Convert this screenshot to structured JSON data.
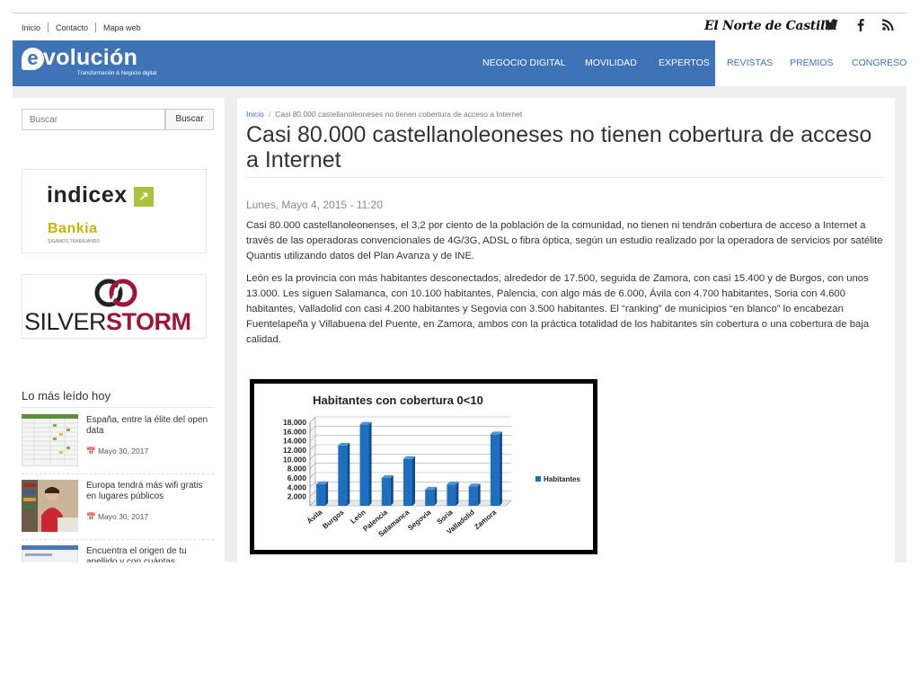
{
  "topbar": {
    "links": [
      "Inicio",
      "Contacto",
      "Mapa web"
    ],
    "brand": "El Norte de Castilla",
    "social_icons": [
      "twitter-icon",
      "facebook-icon",
      "rss-icon"
    ]
  },
  "header": {
    "logo_word": "volución",
    "logo_letter": "e",
    "logo_tagline": "Transformación & Negocio digital",
    "nav": [
      "NEGOCIO DIGITAL",
      "MOVILIDAD",
      "EXPERTOS",
      "REVISTAS",
      "PREMIOS",
      "CONGRESO"
    ],
    "accent": "#3e73b8"
  },
  "sidebar": {
    "search_placeholder": "Buscar",
    "search_button": "Buscar",
    "ad1": {
      "brand1": "indicex",
      "brand2": "Bankia",
      "brand2_tagline": "SIGAMOS TRABAJANDO"
    },
    "ad2": {
      "part1": "SILVER",
      "part2": "STORM"
    },
    "most_read_title": "Lo más leído hoy",
    "items": [
      {
        "title": "España, entre la élite del open data",
        "date": "Mayo 30, 2017"
      },
      {
        "title": "Europa tendrá más wifi gratis en lugares públicos",
        "date": "Mayo 30, 2017"
      },
      {
        "title": "Encuentra el origen de tu apellido y con cuántas personas",
        "date": ""
      }
    ]
  },
  "article": {
    "breadcrumb_home": "Inicio",
    "breadcrumb_current": "Casi 80.000 castellanoleoneses no tienen cobertura de acceso a Internet",
    "title": "Casi 80.000 castellanoleoneses no tienen cobertura de acceso a Internet",
    "date": "Lunes, Mayo 4, 2015 - 11:20",
    "paragraphs": [
      "Casi 80.000 castellanoleonenses, el 3,2 por ciento de la población de la comunidad, no tienen ni tendrán cobertura de acceso a Internet a través de las operadoras convencionales de 4G/3G, ADSL o fibra óptica, según un estudio realizado por la operadora de servicios por satélite Quantis utilizando datos del Plan Avanza y de INE.",
      "León es la provincia con más habitantes desconectados, alrededor de 17.500, seguida de Zamora, con casi 15.400 y de Burgos, con unos 13.000. Les siguen Salamanca, con 10.100 habitantes, Palencia, con algo más de 6.000, Ávila con 4.700 habitantes, Soria con 4.600 habitantes, Valladolid con casi 4.200 habitantes y Segovia con 3.500 habitantes. El “ranking” de municipios “en blanco” lo encabezan Fuentelapeña y Villabuena del Puente, en Zamora, ambos con la práctica totalidad de los habitantes sin cobertura o una cobertura de baja calidad."
    ]
  },
  "chart_data": {
    "type": "bar",
    "title": "Habitantes con cobertura 0<10",
    "categories": [
      "Ávila",
      "Burgos",
      "León",
      "Palencia",
      "Salamanca",
      "Segovia",
      "Soria",
      "Valladolid",
      "Zamora"
    ],
    "series": [
      {
        "name": "Habitantes",
        "values": [
          4700,
          13000,
          17500,
          6000,
          10100,
          3500,
          4600,
          4200,
          15400
        ]
      }
    ],
    "yticks": [
      "2.000",
      "4.000",
      "6.000",
      "8.000",
      "10.000",
      "12.000",
      "14.000",
      "16.000",
      "18.000"
    ],
    "ylim": [
      0,
      18000
    ],
    "grid": true,
    "legend": "right",
    "bar_color": "#1f6fc0"
  }
}
